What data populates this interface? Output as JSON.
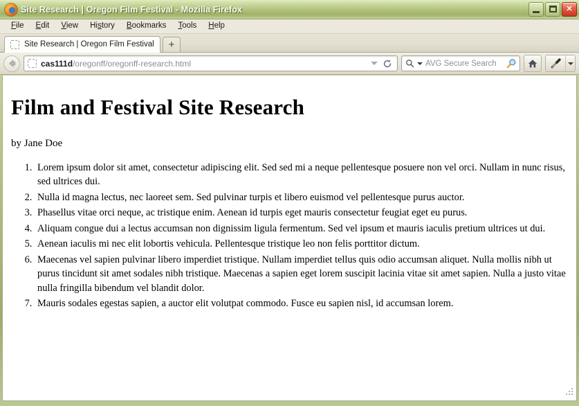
{
  "window": {
    "title": "Site Research | Oregon Film Festival - Mozilla Firefox",
    "app_icon": "firefox-logo-icon",
    "controls": {
      "minimize": "minimize-button",
      "maximize": "maximize-button",
      "close_label": "✕"
    }
  },
  "menubar": {
    "items": [
      {
        "label": "File",
        "accesskey": "F"
      },
      {
        "label": "Edit",
        "accesskey": "E"
      },
      {
        "label": "View",
        "accesskey": "V"
      },
      {
        "label": "History",
        "accesskey": "s"
      },
      {
        "label": "Bookmarks",
        "accesskey": "B"
      },
      {
        "label": "Tools",
        "accesskey": "T"
      },
      {
        "label": "Help",
        "accesskey": "H"
      }
    ]
  },
  "tabstrip": {
    "tabs": [
      {
        "label": "Site Research | Oregon Film Festival",
        "favicon": "dotted-placeholder-icon",
        "active": true
      }
    ],
    "new_tab_label": "+"
  },
  "navbar": {
    "back_icon": "back-arrow-icon",
    "url": {
      "favicon": "dotted-placeholder-icon",
      "host": "cas111d",
      "path": "/oregonff/oregonff-research.html",
      "full": "cas111d/oregonff/oregonff-research.html",
      "dropdown_icon": "chevron-down-icon",
      "reload_icon": "reload-icon"
    },
    "search": {
      "placeholder": "AVG Secure Search",
      "left_icon": "search-icon",
      "dropdown_icon": "chevron-down-icon",
      "right_icon": "magnifier-icon"
    },
    "buttons": [
      {
        "name": "home-button",
        "icon": "home-icon"
      },
      {
        "name": "eyedropper-button",
        "icon": "eyedropper-icon",
        "has_dropdown": true
      }
    ]
  },
  "page": {
    "title": "Film and Festival Site Research",
    "byline": "by Jane Doe",
    "list": [
      "Lorem ipsum dolor sit amet, consectetur adipiscing elit. Sed sed mi a neque pellentesque posuere non vel orci. Nullam in nunc risus, sed ultrices dui.",
      "Nulla id magna lectus, nec laoreet sem. Sed pulvinar turpis et libero euismod vel pellentesque purus auctor.",
      "Phasellus vitae orci neque, ac tristique enim. Aenean id turpis eget mauris consectetur feugiat eget eu purus.",
      "Aliquam congue dui a lectus accumsan non dignissim ligula fermentum. Sed vel ipsum et mauris iaculis pretium ultrices ut dui.",
      "Aenean iaculis mi nec elit lobortis vehicula. Pellentesque tristique leo non felis porttitor dictum.",
      "Maecenas vel sapien pulvinar libero imperdiet tristique. Nullam imperdiet tellus quis odio accumsan aliquet. Nulla mollis nibh ut purus tincidunt sit amet sodales nibh tristique. Maecenas a sapien eget lorem suscipit lacinia vitae sit amet sapien. Nulla a justo vitae nulla fringilla bibendum vel blandit dolor.",
      "Mauris sodales egestas sapien, a auctor elit volutpat commodo. Fusce eu sapien nisl, id accumsan lorem."
    ]
  },
  "colors": {
    "titlebar_green": "#a9bb73",
    "chrome_beige": "#ece9dc",
    "close_red": "#c5361f",
    "page_background": "#ffffff",
    "text": "#000000"
  },
  "statusbar": {
    "grip_icon": "resize-grip-icon"
  }
}
